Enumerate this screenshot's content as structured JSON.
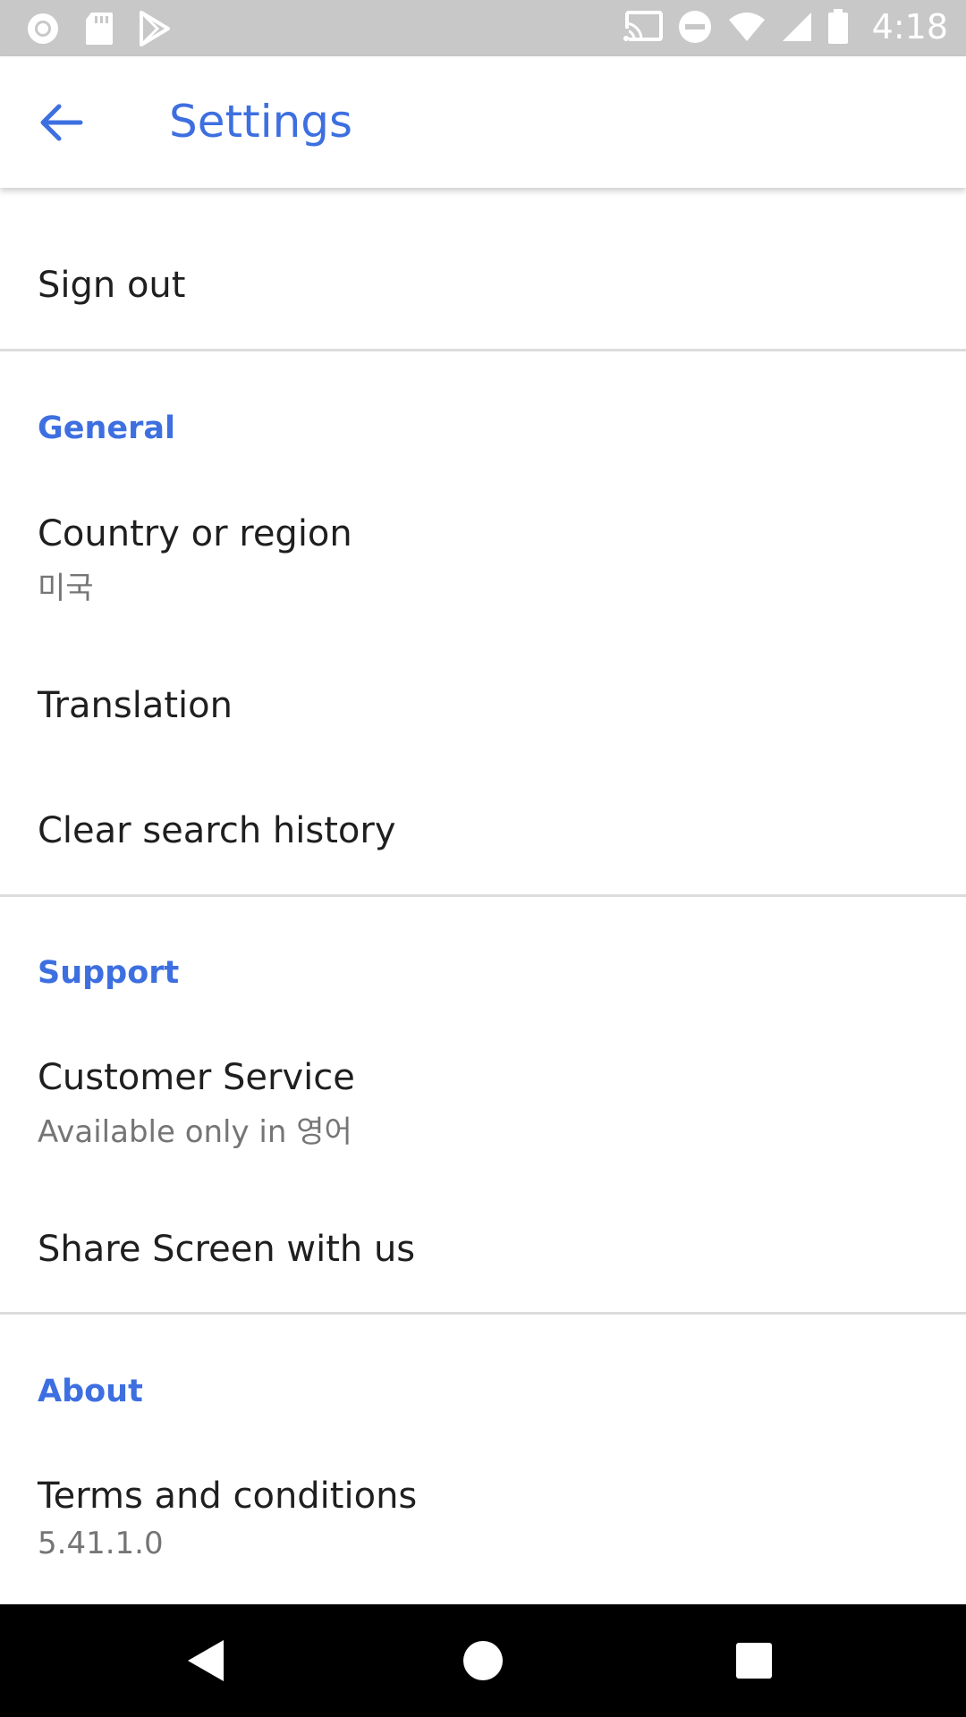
{
  "status_bar": {
    "time": "4:18",
    "left_icons": [
      "circle-notification-icon",
      "sd-card-icon",
      "play-store-icon"
    ],
    "right_icons": [
      "cast-icon",
      "do-not-disturb-icon",
      "wifi-icon",
      "signal-icon",
      "battery-icon"
    ]
  },
  "app_bar": {
    "title": "Settings",
    "back_icon": "arrow-back-icon"
  },
  "items": {
    "sign_out": {
      "title": "Sign out"
    },
    "general_header": "General",
    "country": {
      "title": "Country or region",
      "subtitle": "미국"
    },
    "translation": {
      "title": "Translation"
    },
    "clear_history": {
      "title": "Clear search history"
    },
    "support_header": "Support",
    "customer_service": {
      "title": "Customer Service",
      "subtitle": "Available only in 영어"
    },
    "share_screen": {
      "title": "Share Screen with us"
    },
    "about_header": "About",
    "terms": {
      "title": "Terms and conditions",
      "subtitle": "5.41.1.0"
    }
  },
  "nav_bar": {
    "back": "nav-back-icon",
    "home": "nav-home-icon",
    "recents": "nav-recents-icon"
  },
  "colors": {
    "accent": "#3d6fe0",
    "status_bar": "#c8c8c8",
    "nav_bar": "#000000",
    "divider": "#dcdcdc"
  }
}
